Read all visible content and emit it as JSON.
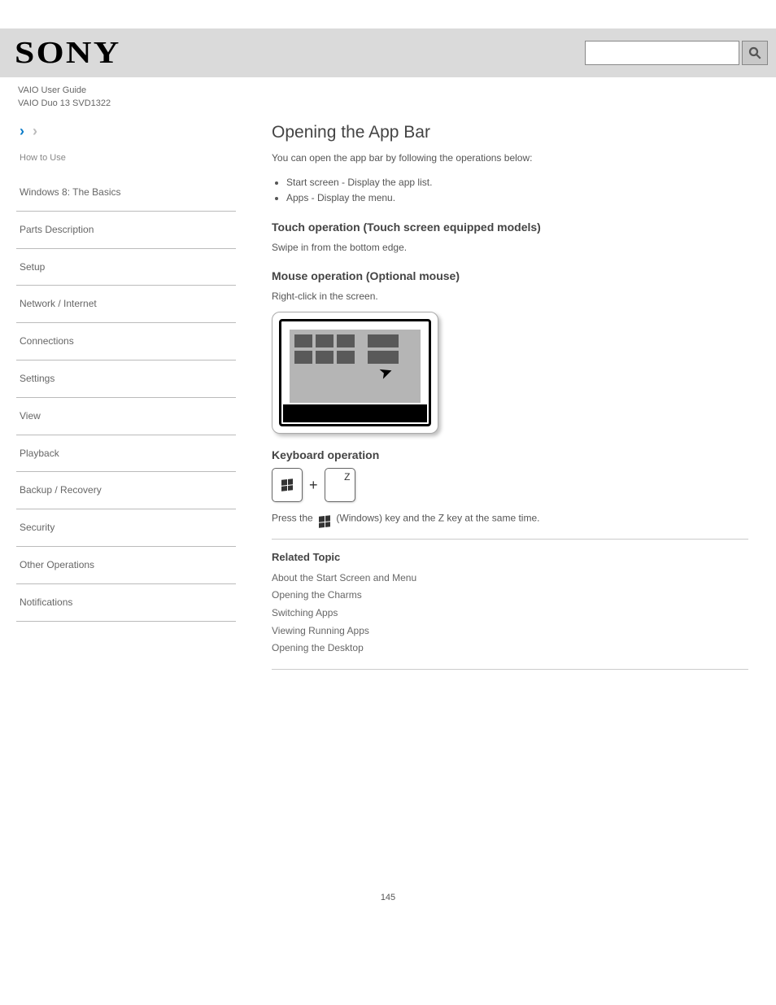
{
  "header": {
    "brand": "SONY",
    "product_line": "VAIO User Guide",
    "product_name": "VAIO Duo 13 SVD1322"
  },
  "sidebar": {
    "how_to": "How to Use",
    "items": [
      "Windows 8: The Basics",
      "Parts Description",
      "Setup",
      "Network / Internet",
      "Connections",
      "Settings",
      "View",
      "Playback",
      "Backup / Recovery",
      "Security",
      "Other Operations",
      "Notifications"
    ]
  },
  "main": {
    "title": "Opening the App Bar",
    "intro": "You can open the app bar by following the operations below:",
    "bullets": [
      "Start screen - Display the app list.",
      "Apps - Display the menu."
    ],
    "touch_h": "Touch operation (Touch screen equipped models)",
    "touch_instr": "Swipe in from the bottom edge.",
    "mouse_h": "Mouse operation (Optional mouse)",
    "mouse_instr": "Right-click in the screen.",
    "kb_h": "Keyboard operation",
    "kb_note_pre": "Press the ",
    "kb_note_post": " (Windows) key and the Z key at the same time.",
    "related_h": "Related Topic",
    "related": [
      "About the Start Screen and Menu",
      "Opening the Charms",
      "Switching Apps",
      "Viewing Running Apps",
      "Opening the Desktop"
    ]
  },
  "page_number": "145"
}
